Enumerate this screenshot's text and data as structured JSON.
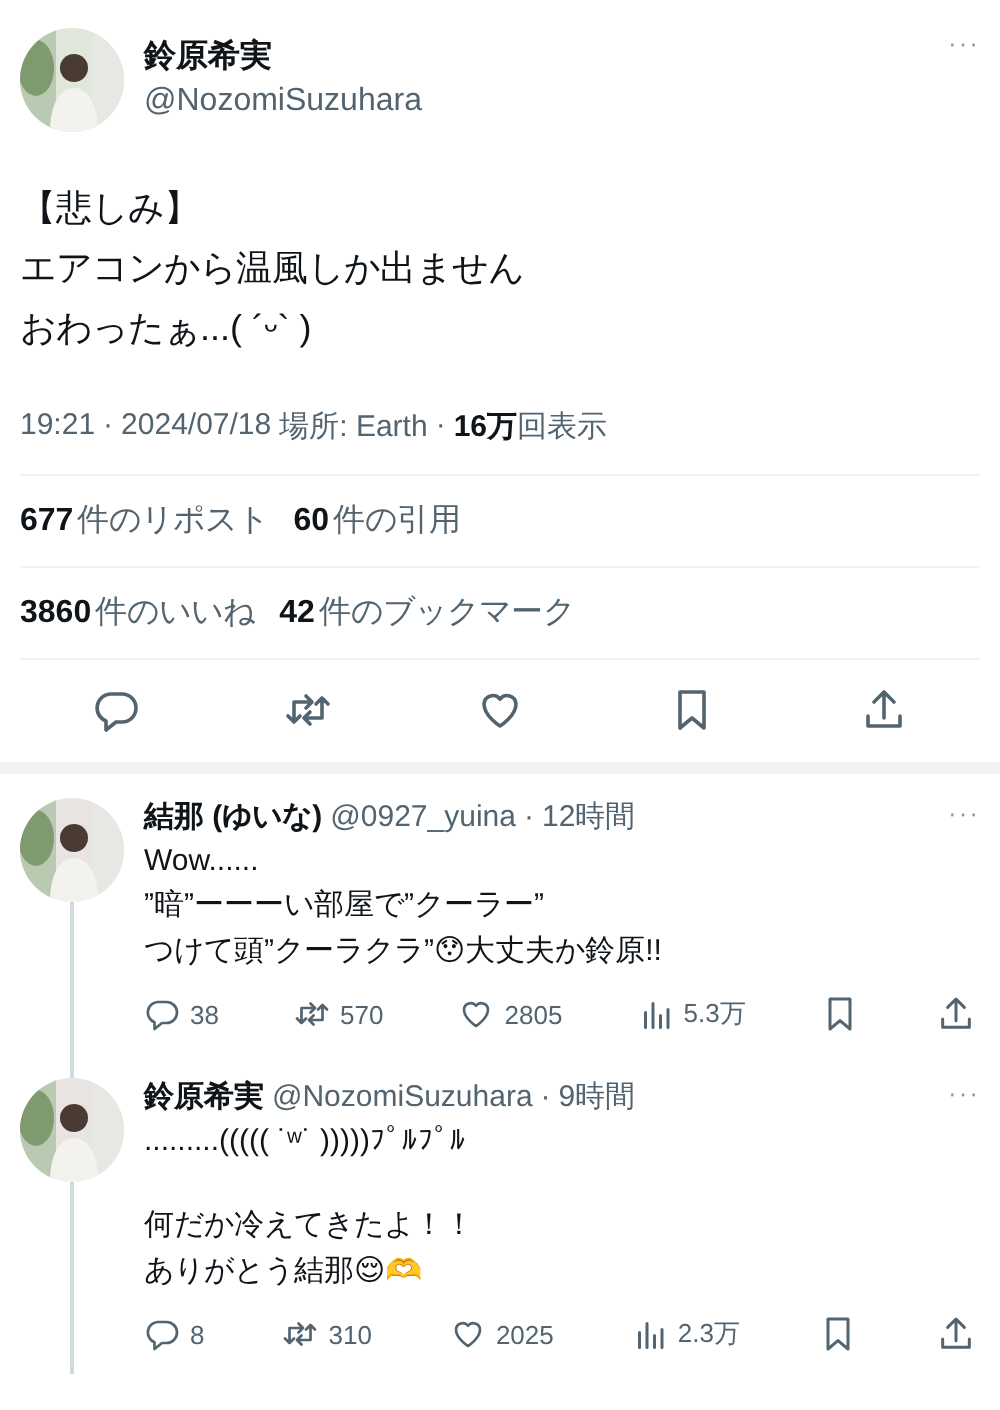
{
  "main_tweet": {
    "author": {
      "name": "鈴原希実",
      "handle": "@NozomiSuzuhara"
    },
    "more": "···",
    "text_lines": [
      "【悲しみ】",
      "エアコンから温風しか出ません",
      "おわったぁ...( ´ᵕ` )"
    ],
    "meta": {
      "time": "19:21",
      "separator": "·",
      "date": "2024/07/18",
      "location": "場所: Earth",
      "views_count": "16万",
      "views_label": "回表示"
    },
    "stats": [
      [
        {
          "count": "677",
          "label": "件のリポスト"
        },
        {
          "count": "60",
          "label": "件の引用"
        }
      ],
      [
        {
          "count": "3860",
          "label": "件のいいね"
        },
        {
          "count": "42",
          "label": "件のブックマーク"
        }
      ]
    ],
    "actions": [
      {
        "kind": "reply"
      },
      {
        "kind": "repost"
      },
      {
        "kind": "like"
      },
      {
        "kind": "bookmark"
      },
      {
        "kind": "share"
      }
    ]
  },
  "replies": [
    {
      "author": {
        "name": "結那 (ゆいな)",
        "handle": "@0927_yuina"
      },
      "separator": "·",
      "time": "12時間",
      "more": "···",
      "thread_above": false,
      "thread_below": true,
      "paragraphs": [
        [
          "Wow......",
          "”暗”ーーーい部屋で”クーラー”",
          "つけて頭”クーラクラ”😯大丈夫か鈴原!!"
        ]
      ],
      "actions": [
        {
          "kind": "reply",
          "count": "38"
        },
        {
          "kind": "repost",
          "count": "570"
        },
        {
          "kind": "like",
          "count": "2805"
        },
        {
          "kind": "views",
          "count": "5.3万"
        },
        {
          "kind": "bookmark"
        },
        {
          "kind": "share"
        }
      ]
    },
    {
      "author": {
        "name": "鈴原希実",
        "handle": "@NozomiSuzuhara"
      },
      "separator": "·",
      "time": "9時間",
      "more": "···",
      "thread_above": true,
      "thread_below": true,
      "paragraphs": [
        [
          ".........((((( ˙ʷ˙ )))))ﾌﾟﾙﾌﾟﾙ"
        ],
        [
          "何だか冷えてきたよ！！",
          "ありがとう結那😌🫶"
        ]
      ],
      "actions": [
        {
          "kind": "reply",
          "count": "8"
        },
        {
          "kind": "repost",
          "count": "310"
        },
        {
          "kind": "like",
          "count": "2025"
        },
        {
          "kind": "views",
          "count": "2.3万"
        },
        {
          "kind": "bookmark"
        },
        {
          "kind": "share"
        }
      ]
    }
  ]
}
